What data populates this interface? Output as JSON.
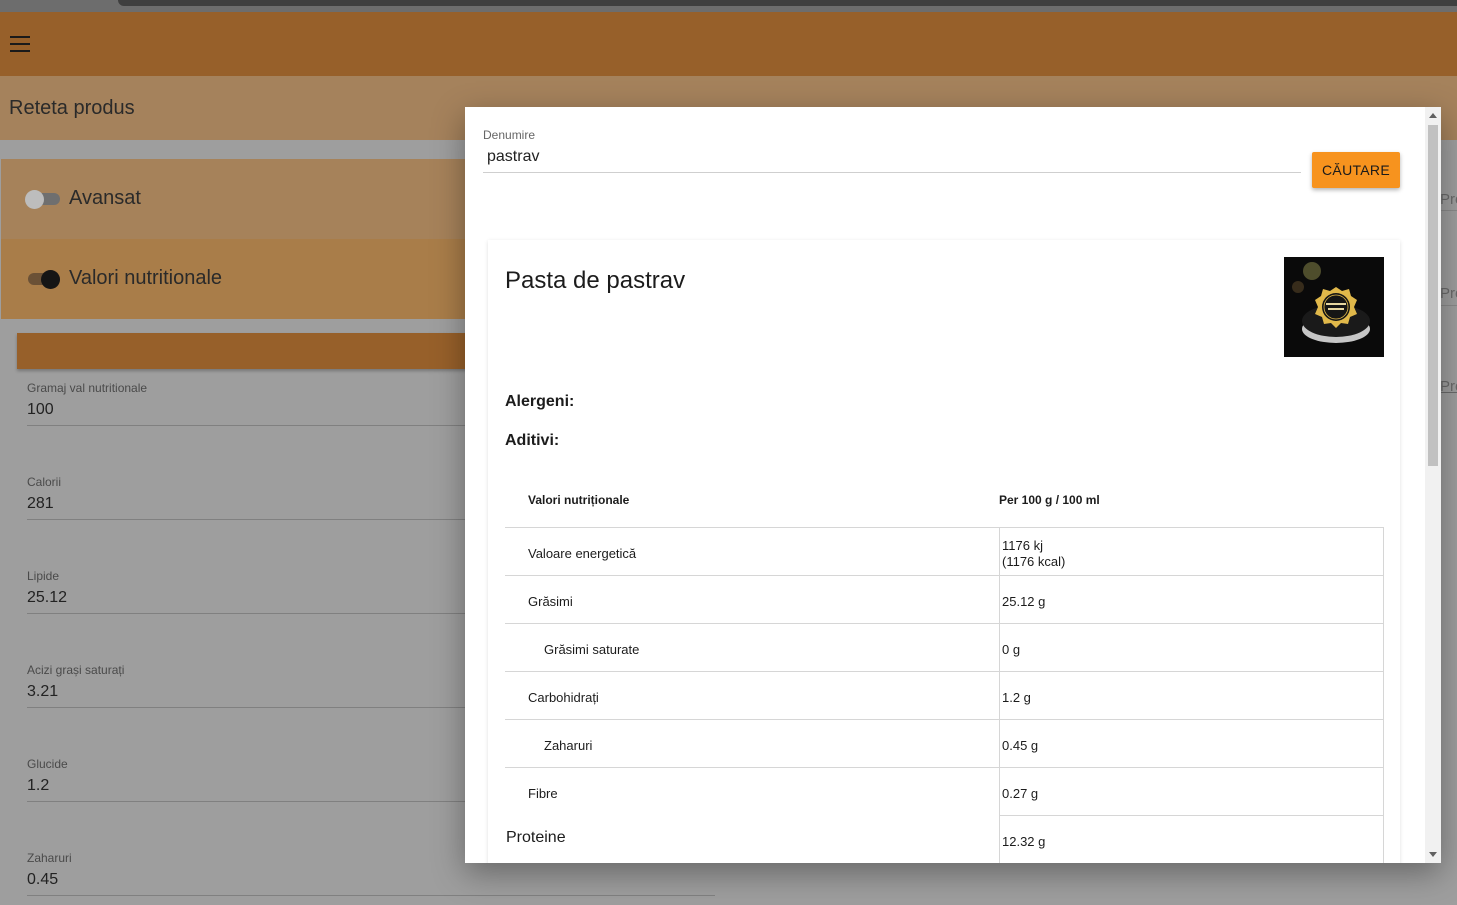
{
  "page": {
    "title": "Reteta produs",
    "toggles": [
      {
        "label": "Avansat",
        "on": false
      },
      {
        "label": "Valori nutritionale",
        "on": true
      }
    ],
    "fields": [
      {
        "label": "Gramaj val nutritionale",
        "value": "100"
      },
      {
        "label": "Calorii",
        "value": "281"
      },
      {
        "label": "Lipide",
        "value": "25.12"
      },
      {
        "label": "Acizi grași saturați",
        "value": "3.21"
      },
      {
        "label": "Glucide",
        "value": "1.2"
      },
      {
        "label": "Zaharuri",
        "value": "0.45"
      }
    ],
    "right_peek": [
      "Pre",
      "Pre",
      "Pre"
    ]
  },
  "colors": {
    "appbar": "#97602a",
    "accent_button": "#f7931e"
  },
  "dialog": {
    "search": {
      "label": "Denumire",
      "value": "pastrav",
      "button": "CĂUTARE"
    },
    "product": {
      "title": "Pasta de pastrav",
      "image_icon": "product-jar-image",
      "allergens_label": "Alergeni:",
      "additives_label": "Aditivi:",
      "table": {
        "headers": [
          "Valori nutriționale",
          "Per 100 g / 100 ml"
        ],
        "rows": [
          {
            "name": "Valoare energetică",
            "value": "1176 kj",
            "value2": "(1176 kcal)"
          },
          {
            "name": "Grăsimi",
            "value": "25.12 g"
          },
          {
            "name": "Grăsimi saturate",
            "value": "0 g",
            "indent": true
          },
          {
            "name": "Carbohidrați",
            "value": "1.2 g"
          },
          {
            "name": "Zaharuri",
            "value": "0.45 g",
            "indent": true
          },
          {
            "name": "Fibre",
            "value": "0.27 g"
          },
          {
            "name": "Proteine",
            "value": "12.32 g"
          }
        ]
      }
    }
  }
}
